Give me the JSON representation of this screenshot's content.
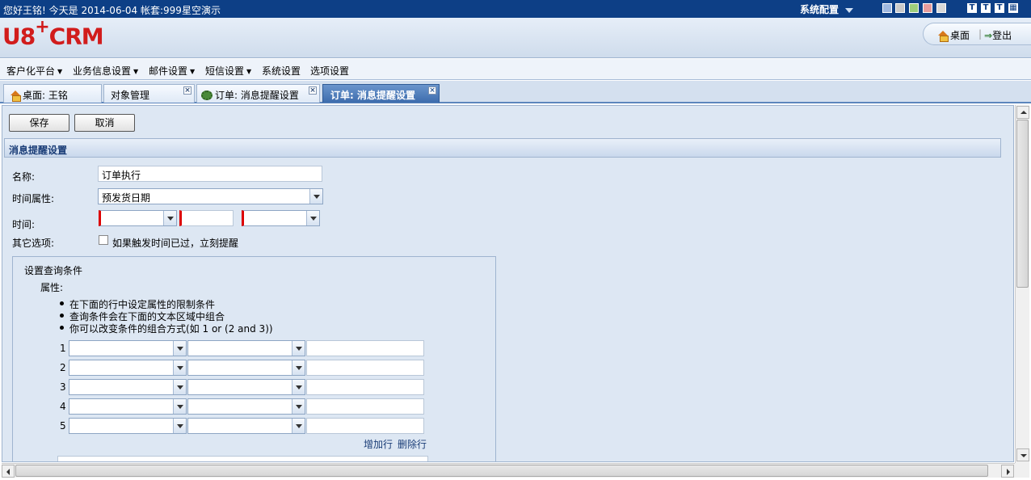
{
  "topbar": {
    "greeting": "您好王铭!  今天是  2014-06-04 帐套:999星空演示",
    "system_config": "系统配置",
    "theme_colors": [
      "#9fb8e0",
      "#c9c9c9",
      "#9fcf7c",
      "#e79c9c",
      "#d8d8d8"
    ],
    "window_icons": [
      "T",
      "T",
      "T"
    ]
  },
  "logo": {
    "prefix": "U8",
    "plus": "+",
    "suffix": "CRM"
  },
  "header": {
    "desktop_label": "桌面",
    "logout_label": "登出"
  },
  "menu": [
    {
      "label": "客户化平台",
      "has_dropdown": true
    },
    {
      "label": "业务信息设置",
      "has_dropdown": true
    },
    {
      "label": "邮件设置",
      "has_dropdown": true
    },
    {
      "label": "短信设置",
      "has_dropdown": true
    },
    {
      "label": "系统设置",
      "has_dropdown": false
    },
    {
      "label": "选项设置",
      "has_dropdown": false
    }
  ],
  "tabs": [
    {
      "label": "桌面: 王铭",
      "icon": "house-icon",
      "closable": false,
      "active": false
    },
    {
      "label": "对象管理",
      "closable": true,
      "active": false
    },
    {
      "label": "订单: 消息提醒设置",
      "icon": "gear-icon",
      "closable": true,
      "active": false
    },
    {
      "label": "订单: 消息提醒设置",
      "closable": true,
      "active": true
    }
  ],
  "toolbar": {
    "save_label": "保存",
    "cancel_label": "取消"
  },
  "section": {
    "title": "消息提醒设置"
  },
  "form": {
    "name_label": "名称:",
    "name_value": "订单执行",
    "time_attr_label": "时间属性:",
    "time_attr_value": "预发货日期",
    "time_label": "时间:",
    "time_values": [
      "",
      "",
      ""
    ],
    "other_label": "其它选项:",
    "other_checkbox_label": "如果触发时间已过，立刻提醒",
    "other_checked": false
  },
  "query": {
    "title": "设置查询条件",
    "attr_label": "属性:",
    "bullets": [
      "在下面的行中设定属性的限制条件",
      "查询条件会在下面的文本区域中组合",
      "你可以改变条件的组合方式(如  1 or (2 and 3))"
    ],
    "rows": [
      {
        "num": "1",
        "field": "",
        "operator": "",
        "value": ""
      },
      {
        "num": "2",
        "field": "",
        "operator": "",
        "value": ""
      },
      {
        "num": "3",
        "field": "",
        "operator": "",
        "value": ""
      },
      {
        "num": "4",
        "field": "",
        "operator": "",
        "value": ""
      },
      {
        "num": "5",
        "field": "",
        "operator": "",
        "value": ""
      }
    ],
    "add_row": "增加行",
    "delete_row": "删除行"
  }
}
